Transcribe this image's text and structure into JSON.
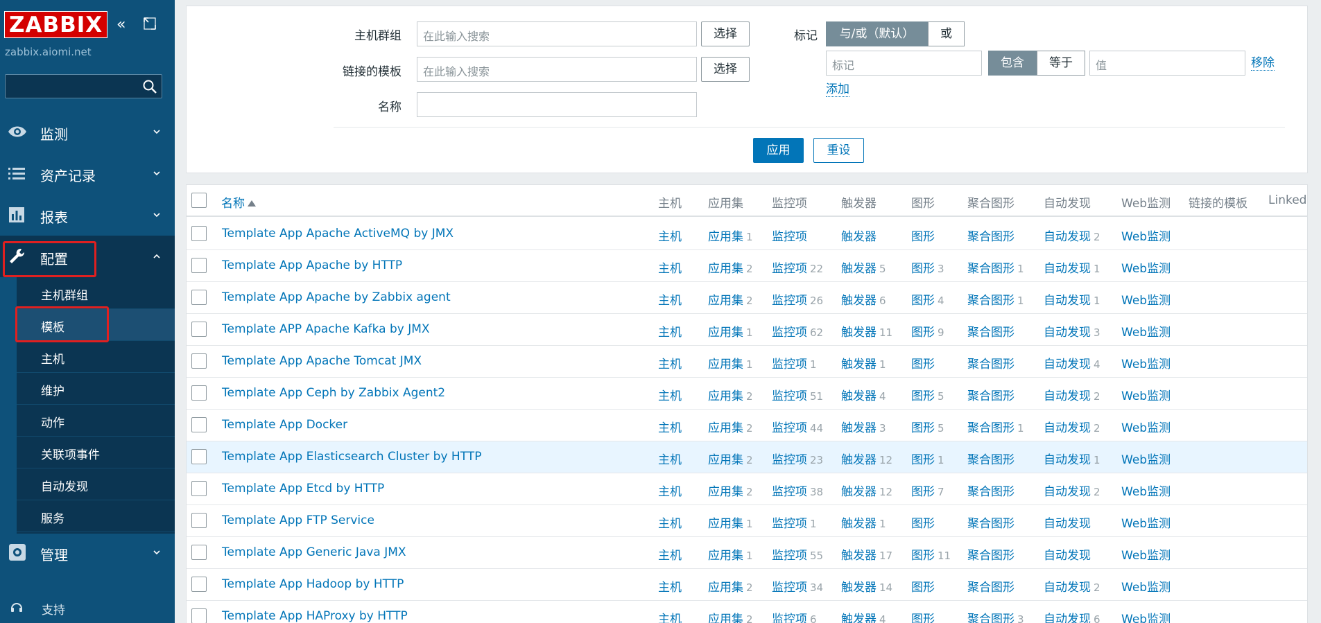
{
  "sidebar": {
    "logo": "ZABBIX",
    "server": "zabbix.aiomi.net",
    "search_value": "",
    "menu": [
      {
        "label": "监测",
        "icon": "eye-icon"
      },
      {
        "label": "资产记录",
        "icon": "list-icon"
      },
      {
        "label": "报表",
        "icon": "bar-chart-icon"
      },
      {
        "label": "配置",
        "icon": "wrench-icon"
      },
      {
        "label": "管理",
        "icon": "gear-icon"
      }
    ],
    "submenu": [
      {
        "label": "主机群组"
      },
      {
        "label": "模板"
      },
      {
        "label": "主机"
      },
      {
        "label": "维护"
      },
      {
        "label": "动作"
      },
      {
        "label": "关联项事件"
      },
      {
        "label": "自动发现"
      },
      {
        "label": "服务"
      }
    ],
    "support": "支持"
  },
  "filter": {
    "hostgroups_label": "主机群组",
    "hostgroups_placeholder": "在此输入搜索",
    "linked_label": "链接的模板",
    "linked_placeholder": "在此输入搜索",
    "name_label": "名称",
    "name_value": "",
    "select_label": "选择",
    "tags_label": "标记",
    "andor_label": "与/或（默认）",
    "or_label": "或",
    "tag_placeholder": "标记",
    "contains_label": "包含",
    "equals_label": "等于",
    "value_placeholder": "值",
    "remove_label": "移除",
    "add_label": "添加",
    "apply_label": "应用",
    "reset_label": "重设"
  },
  "table": {
    "headers": {
      "name": "名称",
      "hosts": "主机",
      "apps": "应用集",
      "items": "监控项",
      "triggers": "触发器",
      "graphs": "图形",
      "screens": "聚合图形",
      "discovery": "自动发现",
      "web": "Web监测",
      "linked": "链接的模板",
      "linked_to": "Linked"
    },
    "rows": [
      {
        "name": "Template App Apache ActiveMQ by JMX",
        "hosts": "主机",
        "apps": "应用集",
        "apps_n": "1",
        "items": "监控项",
        "items_n": "",
        "triggers": "触发器",
        "triggers_n": "",
        "graphs": "图形",
        "graphs_n": "",
        "screens": "聚合图形",
        "screens_n": "",
        "discovery": "自动发现",
        "discovery_n": "2",
        "web": "Web监测"
      },
      {
        "name": "Template App Apache by HTTP",
        "hosts": "主机",
        "apps": "应用集",
        "apps_n": "2",
        "items": "监控项",
        "items_n": "22",
        "triggers": "触发器",
        "triggers_n": "5",
        "graphs": "图形",
        "graphs_n": "3",
        "screens": "聚合图形",
        "screens_n": "1",
        "discovery": "自动发现",
        "discovery_n": "1",
        "web": "Web监测"
      },
      {
        "name": "Template App Apache by Zabbix agent",
        "hosts": "主机",
        "apps": "应用集",
        "apps_n": "2",
        "items": "监控项",
        "items_n": "26",
        "triggers": "触发器",
        "triggers_n": "6",
        "graphs": "图形",
        "graphs_n": "4",
        "screens": "聚合图形",
        "screens_n": "1",
        "discovery": "自动发现",
        "discovery_n": "1",
        "web": "Web监测"
      },
      {
        "name": "Template APP Apache Kafka by JMX",
        "hosts": "主机",
        "apps": "应用集",
        "apps_n": "1",
        "items": "监控项",
        "items_n": "62",
        "triggers": "触发器",
        "triggers_n": "11",
        "graphs": "图形",
        "graphs_n": "9",
        "screens": "聚合图形",
        "screens_n": "",
        "discovery": "自动发现",
        "discovery_n": "3",
        "web": "Web监测"
      },
      {
        "name": "Template App Apache Tomcat JMX",
        "hosts": "主机",
        "apps": "应用集",
        "apps_n": "1",
        "items": "监控项",
        "items_n": "1",
        "triggers": "触发器",
        "triggers_n": "1",
        "graphs": "图形",
        "graphs_n": "",
        "screens": "聚合图形",
        "screens_n": "",
        "discovery": "自动发现",
        "discovery_n": "4",
        "web": "Web监测"
      },
      {
        "name": "Template App Ceph by Zabbix Agent2",
        "hosts": "主机",
        "apps": "应用集",
        "apps_n": "2",
        "items": "监控项",
        "items_n": "51",
        "triggers": "触发器",
        "triggers_n": "4",
        "graphs": "图形",
        "graphs_n": "5",
        "screens": "聚合图形",
        "screens_n": "",
        "discovery": "自动发现",
        "discovery_n": "2",
        "web": "Web监测"
      },
      {
        "name": "Template App Docker",
        "hosts": "主机",
        "apps": "应用集",
        "apps_n": "2",
        "items": "监控项",
        "items_n": "44",
        "triggers": "触发器",
        "triggers_n": "3",
        "graphs": "图形",
        "graphs_n": "5",
        "screens": "聚合图形",
        "screens_n": "1",
        "discovery": "自动发现",
        "discovery_n": "2",
        "web": "Web监测"
      },
      {
        "name": "Template App Elasticsearch Cluster by HTTP",
        "hosts": "主机",
        "apps": "应用集",
        "apps_n": "2",
        "items": "监控项",
        "items_n": "23",
        "triggers": "触发器",
        "triggers_n": "12",
        "graphs": "图形",
        "graphs_n": "1",
        "screens": "聚合图形",
        "screens_n": "",
        "discovery": "自动发现",
        "discovery_n": "1",
        "web": "Web监测"
      },
      {
        "name": "Template App Etcd by HTTP",
        "hosts": "主机",
        "apps": "应用集",
        "apps_n": "2",
        "items": "监控项",
        "items_n": "38",
        "triggers": "触发器",
        "triggers_n": "12",
        "graphs": "图形",
        "graphs_n": "7",
        "screens": "聚合图形",
        "screens_n": "",
        "discovery": "自动发现",
        "discovery_n": "2",
        "web": "Web监测"
      },
      {
        "name": "Template App FTP Service",
        "hosts": "主机",
        "apps": "应用集",
        "apps_n": "1",
        "items": "监控项",
        "items_n": "1",
        "triggers": "触发器",
        "triggers_n": "1",
        "graphs": "图形",
        "graphs_n": "",
        "screens": "聚合图形",
        "screens_n": "",
        "discovery": "自动发现",
        "discovery_n": "",
        "web": "Web监测"
      },
      {
        "name": "Template App Generic Java JMX",
        "hosts": "主机",
        "apps": "应用集",
        "apps_n": "1",
        "items": "监控项",
        "items_n": "55",
        "triggers": "触发器",
        "triggers_n": "17",
        "graphs": "图形",
        "graphs_n": "11",
        "screens": "聚合图形",
        "screens_n": "",
        "discovery": "自动发现",
        "discovery_n": "",
        "web": "Web监测"
      },
      {
        "name": "Template App Hadoop by HTTP",
        "hosts": "主机",
        "apps": "应用集",
        "apps_n": "2",
        "items": "监控项",
        "items_n": "34",
        "triggers": "触发器",
        "triggers_n": "14",
        "graphs": "图形",
        "graphs_n": "",
        "screens": "聚合图形",
        "screens_n": "",
        "discovery": "自动发现",
        "discovery_n": "2",
        "web": "Web监测"
      },
      {
        "name": "Template App HAProxy by HTTP",
        "hosts": "主机",
        "apps": "应用集",
        "apps_n": "2",
        "items": "监控项",
        "items_n": "6",
        "triggers": "触发器",
        "triggers_n": "4",
        "graphs": "图形",
        "graphs_n": "",
        "screens": "聚合图形",
        "screens_n": "3",
        "discovery": "自动发现",
        "discovery_n": "6",
        "web": "Web监测"
      }
    ]
  }
}
